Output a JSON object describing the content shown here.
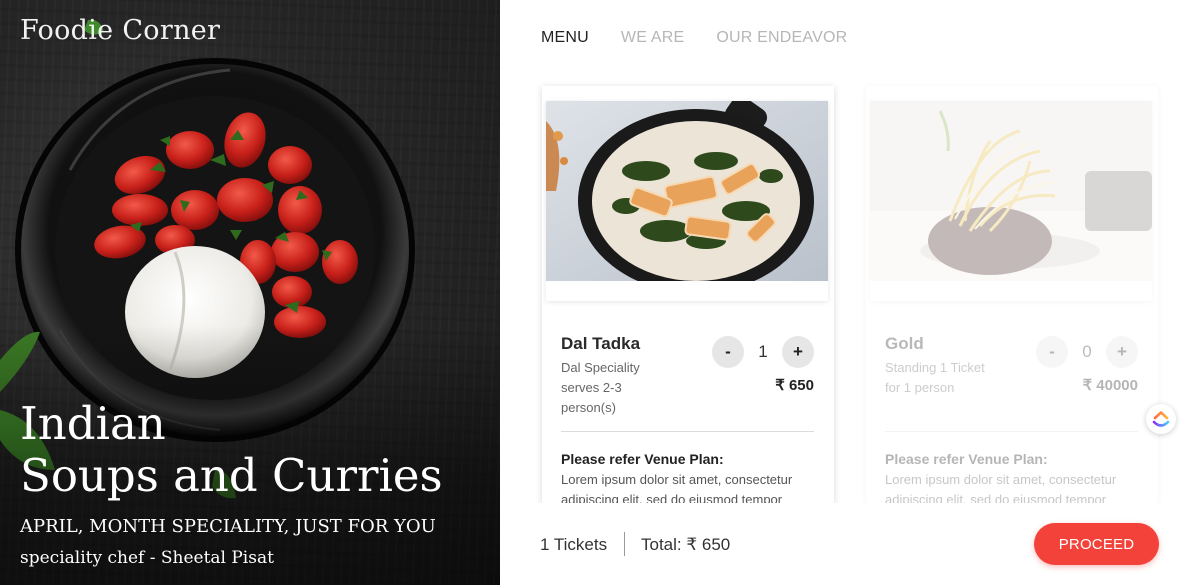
{
  "brand": {
    "name": "Foodie Corner"
  },
  "hero": {
    "title_line1": "Indian",
    "title_line2": "Soups and Curries",
    "subtitle": "APRIL, MONTH SPECIALITY, JUST FOR YOU",
    "chef": "speciality chef - Sheetal Pisat"
  },
  "nav": {
    "items": [
      {
        "label": "MENU",
        "active": true
      },
      {
        "label": "WE ARE",
        "active": false
      },
      {
        "label": "OUR ENDEAVOR",
        "active": false
      }
    ]
  },
  "cards": [
    {
      "name": "Dal Tadka",
      "description": "Dal Speciality serves 2-3 person(s)",
      "quantity": "1",
      "price": "₹ 650",
      "minus": "-",
      "plus": "+",
      "venue_title": "Please refer Venue Plan:",
      "venue_text": "Lorem ipsum dolor sit amet, consectetur adipiscing elit, sed do eiusmod tempor",
      "enabled": true
    },
    {
      "name": "Gold",
      "description": "Standing 1 Ticket for 1 person",
      "quantity": "0",
      "price": "₹ 40000",
      "minus": "-",
      "plus": "+",
      "venue_title": "Please refer Venue Plan:",
      "venue_text": "Lorem ipsum dolor sit amet, consectetur adipiscing elit, sed do eiusmod tempor",
      "enabled": false
    }
  ],
  "summary": {
    "tickets": "1 Tickets",
    "total": "Total: ₹ 650",
    "proceed_label": "PROCEED"
  },
  "colors": {
    "accent": "#f2423a",
    "nav_active": "#222222",
    "nav_inactive": "#b6b6b6"
  },
  "icons": {
    "floating_widget": "clickup-logo-icon"
  }
}
